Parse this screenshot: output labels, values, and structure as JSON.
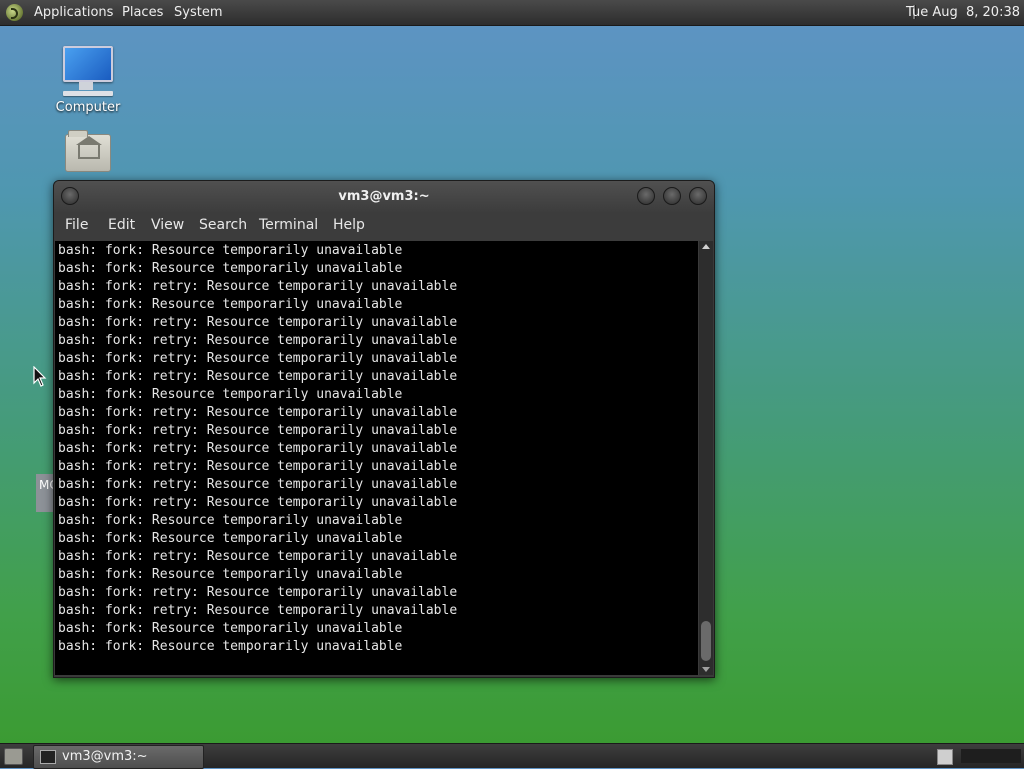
{
  "top_panel": {
    "menus": [
      "Applications",
      "Places",
      "System"
    ],
    "clock": "Tue Aug  8, 20:38"
  },
  "desktop": {
    "icons": [
      {
        "label": "Computer",
        "icon": "computer-icon"
      },
      {
        "label": "",
        "icon": "home-folder-icon"
      }
    ],
    "partial_icon_text": "MC"
  },
  "window": {
    "title": "vm3@vm3:~",
    "menu": [
      "File",
      "Edit",
      "View",
      "Search",
      "Terminal",
      "Help"
    ],
    "terminal_lines": [
      "bash: fork: Resource temporarily unavailable",
      "bash: fork: Resource temporarily unavailable",
      "bash: fork: retry: Resource temporarily unavailable",
      "bash: fork: Resource temporarily unavailable",
      "bash: fork: retry: Resource temporarily unavailable",
      "bash: fork: retry: Resource temporarily unavailable",
      "bash: fork: retry: Resource temporarily unavailable",
      "bash: fork: retry: Resource temporarily unavailable",
      "bash: fork: Resource temporarily unavailable",
      "bash: fork: retry: Resource temporarily unavailable",
      "bash: fork: retry: Resource temporarily unavailable",
      "bash: fork: retry: Resource temporarily unavailable",
      "bash: fork: retry: Resource temporarily unavailable",
      "bash: fork: retry: Resource temporarily unavailable",
      "bash: fork: retry: Resource temporarily unavailable",
      "bash: fork: Resource temporarily unavailable",
      "bash: fork: Resource temporarily unavailable",
      "bash: fork: retry: Resource temporarily unavailable",
      "bash: fork: Resource temporarily unavailable",
      "bash: fork: retry: Resource temporarily unavailable",
      "bash: fork: retry: Resource temporarily unavailable",
      "bash: fork: Resource temporarily unavailable",
      "bash: fork: Resource temporarily unavailable"
    ]
  },
  "taskbar": {
    "tasks": [
      {
        "label": "vm3@vm3:~",
        "icon": "terminal-icon"
      }
    ]
  }
}
